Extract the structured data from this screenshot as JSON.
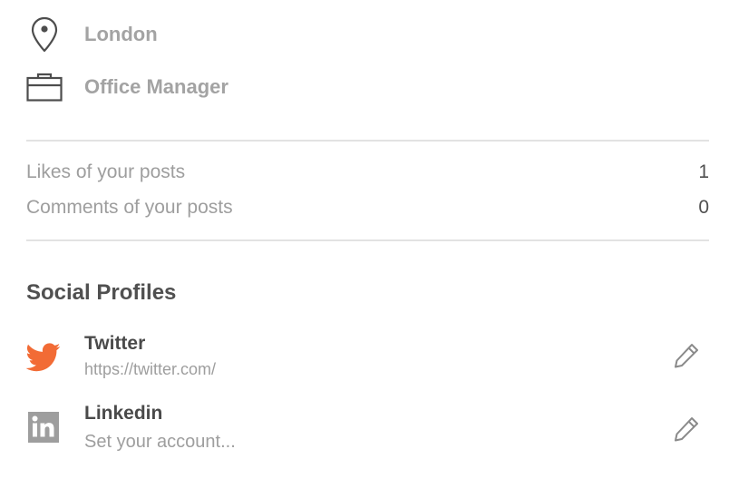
{
  "profile": {
    "location": "London",
    "job_title": "Office Manager"
  },
  "stats": [
    {
      "label": "Likes of your posts",
      "value": "1"
    },
    {
      "label": "Comments of your posts",
      "value": "0"
    }
  ],
  "social": {
    "title": "Social Profiles",
    "items": [
      {
        "name": "Twitter",
        "value": "https://twitter.com/",
        "icon": "twitter-icon",
        "color": "#f26b35"
      },
      {
        "name": "Linkedin",
        "value": "Set your account...",
        "icon": "linkedin-icon",
        "color": "#9e9e9e"
      }
    ]
  },
  "colors": {
    "accent": "#f26b35",
    "muted_text": "#a3a3a3",
    "dark_text": "#505050"
  }
}
